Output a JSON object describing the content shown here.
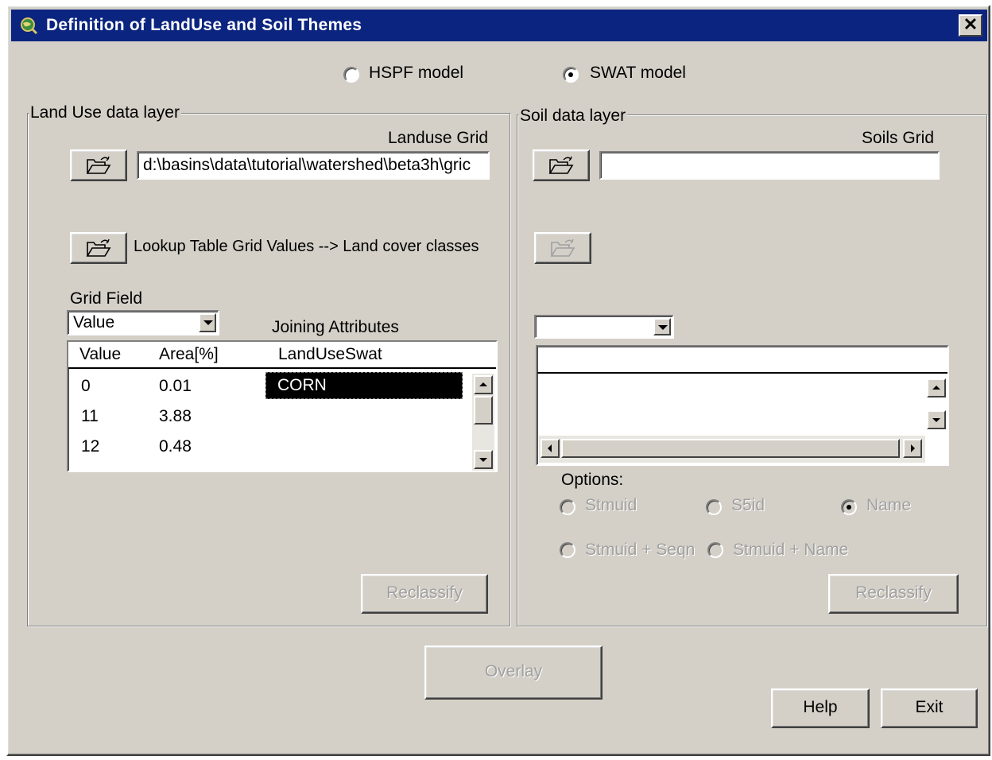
{
  "window": {
    "title": "Definition of LandUse and Soil Themes",
    "title_bar_color": "#0a2480",
    "face_color": "#d4d0c8",
    "close_glyph": "✕"
  },
  "model_choice": {
    "hspf_label": "HSPF model",
    "swat_label": "SWAT model",
    "selected": "SWAT model"
  },
  "landuse": {
    "group_label": "Land Use data layer",
    "grid_label": "Landuse Grid",
    "grid_path": "d:\\basins\\data\\tutorial\\watershed\\beta3h\\gric",
    "lookup_label": "Lookup Table  Grid Values --> Land cover classes",
    "grid_field_label": "Grid Field",
    "grid_field_value": "Value",
    "joining_label": "Joining Attributes",
    "table": {
      "headers": [
        "Value",
        "Area[%]",
        "LandUseSwat"
      ],
      "rows": [
        {
          "value": "0",
          "area": "0.01",
          "landuse": "CORN"
        },
        {
          "value": "11",
          "area": "3.88",
          "landuse": ""
        },
        {
          "value": "12",
          "area": "0.48",
          "landuse": ""
        }
      ],
      "selected_row": 0
    },
    "reclassify_label": "Reclassify"
  },
  "soil": {
    "group_label": "Soil data layer",
    "grid_label": "Soils Grid",
    "grid_path": "",
    "options_label": "Options:",
    "options": [
      "Stmuid",
      "S5id",
      "Name",
      "Stmuid + Seqn",
      "Stmuid + Name"
    ],
    "selected_option": "Name",
    "reclassify_label": "Reclassify"
  },
  "footer": {
    "overlay_label": "Overlay",
    "help_label": "Help",
    "exit_label": "Exit"
  },
  "icons": [
    "app-globe-icon",
    "close-icon",
    "open-folder-icon",
    "dropdown-arrow-icon",
    "scroll-up-icon",
    "scroll-down-icon",
    "scroll-left-icon",
    "scroll-right-icon"
  ]
}
